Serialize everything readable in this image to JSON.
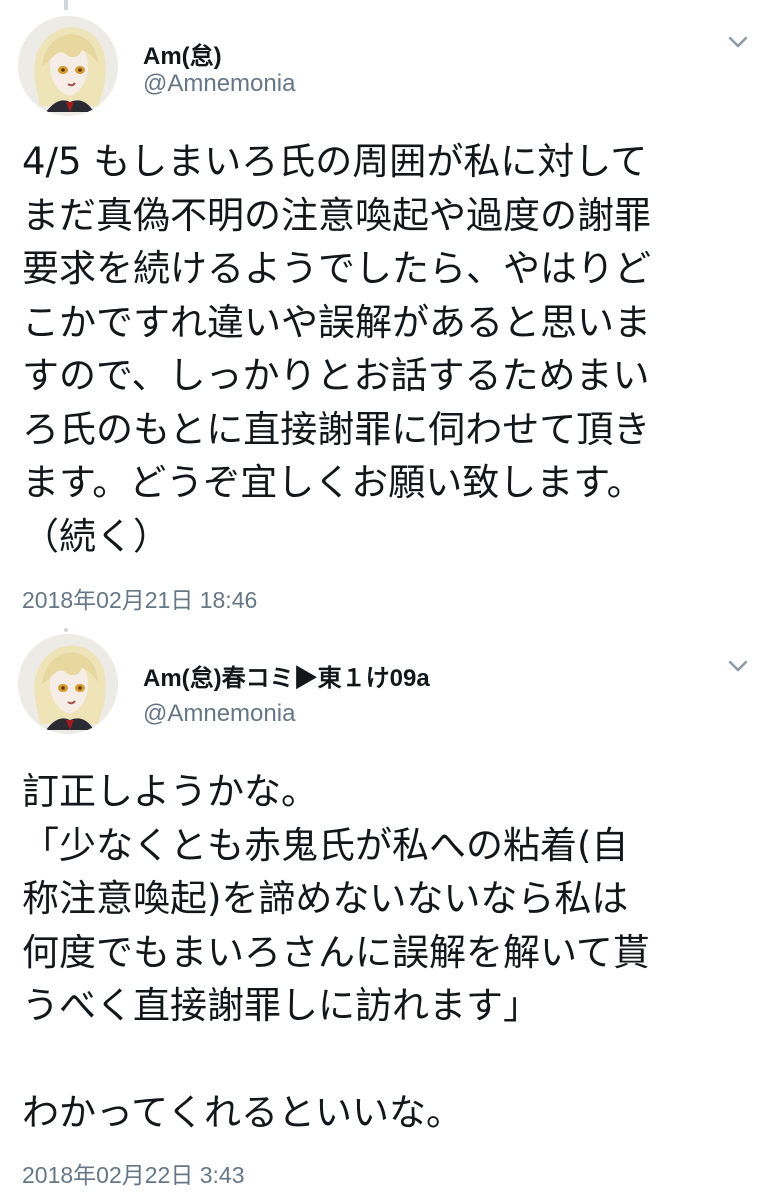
{
  "tweets": [
    {
      "display_name": "Am(怠)",
      "handle": "@Amnemonia",
      "avatar_icon": "avatar-icon",
      "menu_icon": "chevron-down-icon",
      "text": "4/5 もしまいろ氏の周囲が私に対して\nまだ真偽不明の注意喚起や過度の謝罪\n要求を続けるようでしたら、やはりど\nこかですれ違いや誤解があると思いま\nすので、しっかりとお話するためまい\nろ氏のもとに直接謝罪に伺わせて頂き\nます。どうぞ宜しくお願い致します。\n（続く）",
      "timestamp": "2018年02月21日 18:46"
    },
    {
      "display_name": "Am(怠)春コミ▶東１け09a",
      "handle": "@Amnemonia",
      "avatar_icon": "avatar-icon",
      "menu_icon": "chevron-down-icon",
      "text": "訂正しようかな。\n「少なくとも赤鬼氏が私への粘着(自\n称注意喚起)を諦めないないなら私は\n何度でもまいろさんに誤解を解いて貰\nうべく直接謝罪しに訪れます」\n\nわかってくれるといいな。",
      "timestamp": "2018年02月22日 3:43"
    }
  ],
  "colors": {
    "text": "#14171a",
    "secondary": "#657786",
    "thread_line": "#cfd8de",
    "background": "#ffffff"
  }
}
